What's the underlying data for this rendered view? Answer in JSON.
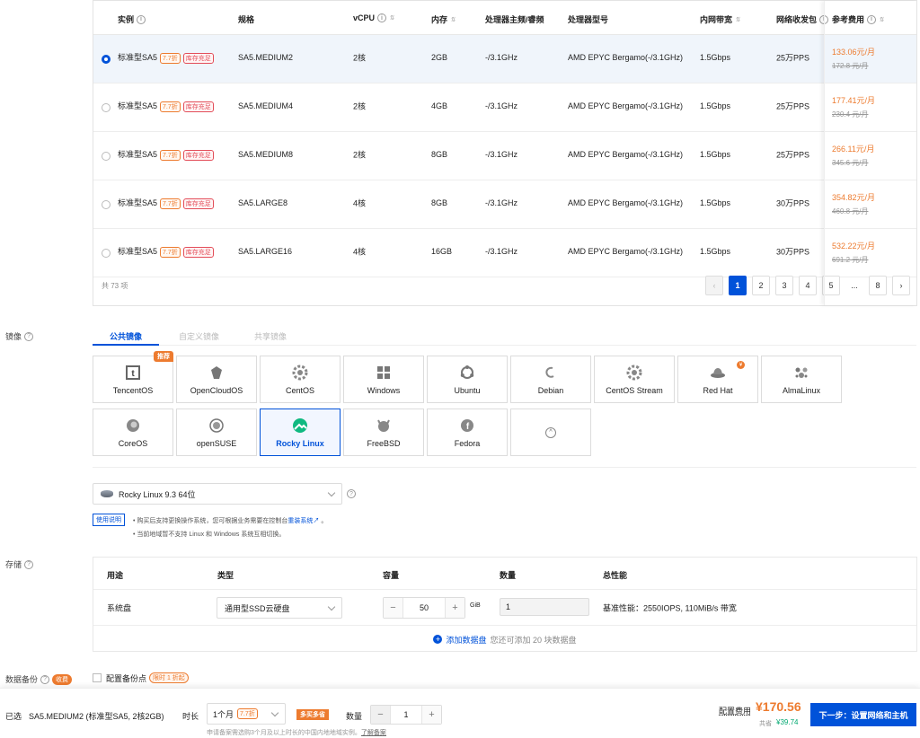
{
  "instance_table": {
    "headers": {
      "instance": "实例",
      "spec": "规格",
      "vcpu": "vCPU",
      "memory": "内存",
      "cpu_freq": "处理器主频/睿频",
      "cpu_model": "处理器型号",
      "bandwidth": "内网带宽",
      "pps": "网络收发包",
      "price": "参考费用"
    },
    "rows": [
      {
        "selected": true,
        "type": "标准型SA5",
        "discount": "7.7折",
        "stock": "库存充足",
        "spec": "SA5.MEDIUM2",
        "vcpu": "2核",
        "memory": "2GB",
        "freq": "-/3.1GHz",
        "model": "AMD EPYC Bergamo(-/3.1GHz)",
        "bandwidth": "1.5Gbps",
        "pps": "25万PPS",
        "price": "133.06元/月",
        "orig": "172.8 元/月"
      },
      {
        "selected": false,
        "type": "标准型SA5",
        "discount": "7.7折",
        "stock": "库存充足",
        "spec": "SA5.MEDIUM4",
        "vcpu": "2核",
        "memory": "4GB",
        "freq": "-/3.1GHz",
        "model": "AMD EPYC Bergamo(-/3.1GHz)",
        "bandwidth": "1.5Gbps",
        "pps": "25万PPS",
        "price": "177.41元/月",
        "orig": "230.4 元/月"
      },
      {
        "selected": false,
        "type": "标准型SA5",
        "discount": "7.7折",
        "stock": "库存充足",
        "spec": "SA5.MEDIUM8",
        "vcpu": "2核",
        "memory": "8GB",
        "freq": "-/3.1GHz",
        "model": "AMD EPYC Bergamo(-/3.1GHz)",
        "bandwidth": "1.5Gbps",
        "pps": "25万PPS",
        "price": "266.11元/月",
        "orig": "345.6 元/月"
      },
      {
        "selected": false,
        "type": "标准型SA5",
        "discount": "7.7折",
        "stock": "库存充足",
        "spec": "SA5.LARGE8",
        "vcpu": "4核",
        "memory": "8GB",
        "freq": "-/3.1GHz",
        "model": "AMD EPYC Bergamo(-/3.1GHz)",
        "bandwidth": "1.5Gbps",
        "pps": "30万PPS",
        "price": "354.82元/月",
        "orig": "460.8 元/月"
      },
      {
        "selected": false,
        "type": "标准型SA5",
        "discount": "7.7折",
        "stock": "库存充足",
        "spec": "SA5.LARGE16",
        "vcpu": "4核",
        "memory": "16GB",
        "freq": "-/3.1GHz",
        "model": "AMD EPYC Bergamo(-/3.1GHz)",
        "bandwidth": "1.5Gbps",
        "pps": "30万PPS",
        "price": "532.22元/月",
        "orig": "691.2 元/月"
      }
    ],
    "total": "共 73 项",
    "pages": [
      "1",
      "2",
      "3",
      "4",
      "5",
      "...",
      "8"
    ]
  },
  "image": {
    "label": "镜像",
    "tabs": [
      "公共镜像",
      "自定义镜像",
      "共享镜像"
    ],
    "os_list": [
      "TencentOS",
      "OpenCloudOS",
      "CentOS",
      "Windows",
      "Ubuntu",
      "Debian",
      "CentOS Stream",
      "Red Hat",
      "AlmaLinux",
      "CoreOS",
      "openSUSE",
      "Rocky Linux",
      "FreeBSD",
      "Fedora"
    ],
    "hot_badge": "推荐",
    "selected_version": "Rocky Linux 9.3 64位",
    "guide_label": "使用说明",
    "note1": "购买后支持更换操作系统，您可根据业务需要在控制台",
    "note1_link": "重装系统",
    "note1_end": "。",
    "note2": "当前地域暂不支持 Linux 和 Windows 系统互相切换。"
  },
  "storage": {
    "label": "存储",
    "headers": {
      "use": "用途",
      "type": "类型",
      "size": "容量",
      "count": "数量",
      "perf": "总性能"
    },
    "row": {
      "use": "系统盘",
      "type": "通用型SSD云硬盘",
      "size": "50",
      "unit": "GiB",
      "count": "1",
      "perf": "基准性能：2550IOPS, 110MiB/s 带宽"
    },
    "add_label": "添加数据盘",
    "add_hint": "您还可添加 20 块数据盘"
  },
  "backup": {
    "label": "数据备份",
    "tag": "收费",
    "checkbox_label": "配置备份点",
    "promo": "限时 1 折起"
  },
  "bottom": {
    "selected_label": "已选",
    "selected_value": "SA5.MEDIUM2 (标准型SA5, 2核2GB)",
    "duration_label": "时长",
    "duration_value": "1个月",
    "duration_discount": "7.7折",
    "multi_buy": "多买多省",
    "qty_label": "数量",
    "qty_value": "1",
    "note": "申请备案需选购3个月及以上时长的中国内地地域实例。",
    "note_link": "了解备案",
    "fee_label": "配置费用",
    "fee_value": "¥170.56",
    "save_label": "共省",
    "save_value": "¥39.74",
    "next_button": "下一步：设置网络和主机"
  },
  "colors": {
    "primary": "#0052d9",
    "accent": "#ed7b2f",
    "danger": "#e34d59",
    "saving": "#00a870"
  }
}
